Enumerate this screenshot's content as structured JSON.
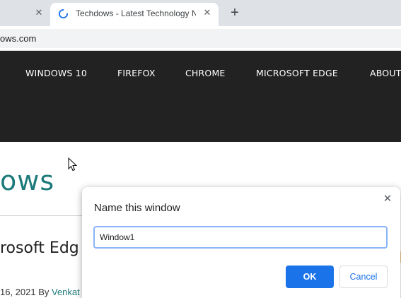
{
  "browser": {
    "tabs": [
      {
        "title": "",
        "close_glyph": "✕"
      },
      {
        "title": "Techdows - Latest Technology News",
        "close_glyph": "✕",
        "icon": "loading-spinner-icon"
      }
    ],
    "new_tab_glyph": "+",
    "address": "ows.com"
  },
  "site": {
    "nav": [
      "WINDOWS 10",
      "FIREFOX",
      "CHROME",
      "MICROSOFT EDGE",
      "ABOUT"
    ],
    "logo": "ows",
    "article_title": "rosoft Edg",
    "meta_prefix": "16, 2021 By ",
    "meta_author": "Venkat",
    "accent_color": "#1e7a7a"
  },
  "dialog": {
    "title": "Name this window",
    "close_glyph": "✕",
    "input_value": "Window1",
    "ok_label": "OK",
    "cancel_label": "Cancel",
    "primary_color": "#1a73e8"
  }
}
